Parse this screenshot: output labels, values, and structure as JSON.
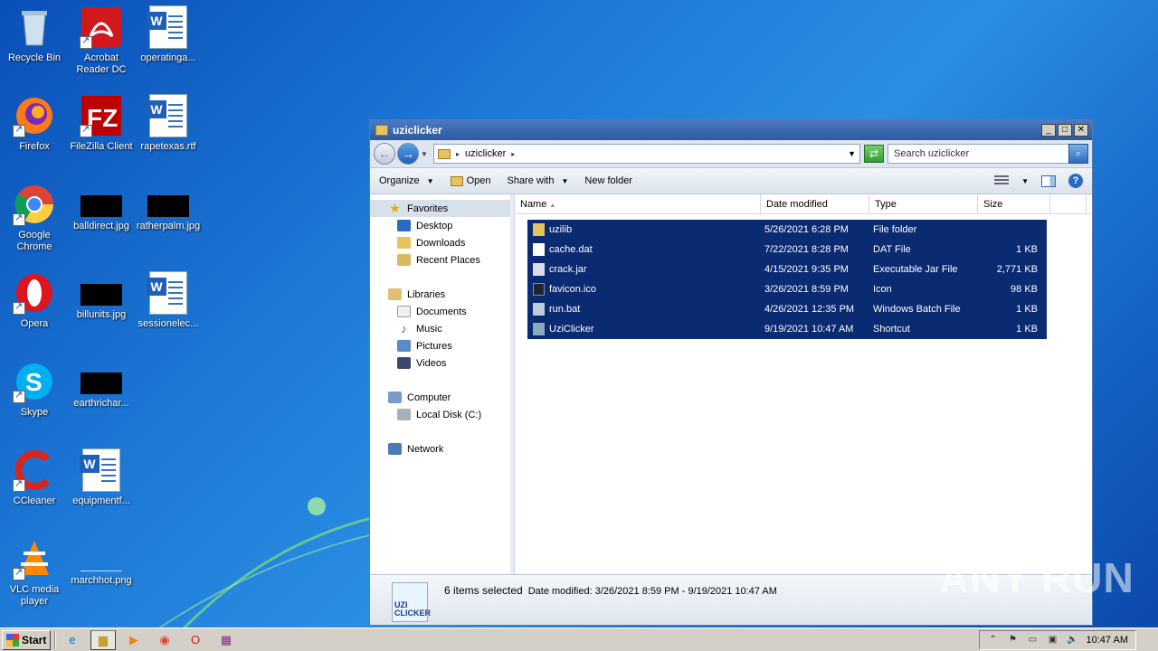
{
  "desktop": {
    "icons": [
      {
        "label": "Recycle Bin"
      },
      {
        "label": "Acrobat Reader DC"
      },
      {
        "label": "operatinga..."
      },
      {
        "label": "Firefox"
      },
      {
        "label": "FileZilla Client"
      },
      {
        "label": "rapetexas.rtf"
      },
      {
        "label": "Google Chrome"
      },
      {
        "label": "balldirect.jpg"
      },
      {
        "label": "ratherpalm.jpg"
      },
      {
        "label": "Opera"
      },
      {
        "label": "billunits.jpg"
      },
      {
        "label": "sessionelec..."
      },
      {
        "label": "Skype"
      },
      {
        "label": "earthrichar..."
      },
      {
        "label": "CCleaner"
      },
      {
        "label": "equipmentf..."
      },
      {
        "label": "VLC media player"
      },
      {
        "label": "marchhot.png"
      }
    ]
  },
  "window": {
    "title": "uziclicker",
    "address": "uziclicker",
    "search_placeholder": "Search uziclicker",
    "toolbar": {
      "organize": "Organize",
      "open": "Open",
      "share_with": "Share with",
      "new_folder": "New folder"
    },
    "nav": {
      "favorites": "Favorites",
      "desktop": "Desktop",
      "downloads": "Downloads",
      "recent_places": "Recent Places",
      "libraries": "Libraries",
      "documents": "Documents",
      "music": "Music",
      "pictures": "Pictures",
      "videos": "Videos",
      "computer": "Computer",
      "local_disk": "Local Disk (C:)",
      "network": "Network"
    },
    "columns": {
      "name": "Name",
      "date_modified": "Date modified",
      "type": "Type",
      "size": "Size"
    },
    "files": [
      {
        "name": "uzilib",
        "date": "5/26/2021 6:28 PM",
        "type": "File folder",
        "size": ""
      },
      {
        "name": "cache.dat",
        "date": "7/22/2021 8:28 PM",
        "type": "DAT File",
        "size": "1 KB"
      },
      {
        "name": "crack.jar",
        "date": "4/15/2021 9:35 PM",
        "type": "Executable Jar File",
        "size": "2,771 KB"
      },
      {
        "name": "favicon.ico",
        "date": "3/26/2021 8:59 PM",
        "type": "Icon",
        "size": "98 KB"
      },
      {
        "name": "run.bat",
        "date": "4/26/2021 12:35 PM",
        "type": "Windows Batch File",
        "size": "1 KB"
      },
      {
        "name": "UziClicker",
        "date": "9/19/2021 10:47 AM",
        "type": "Shortcut",
        "size": "1 KB"
      }
    ],
    "details": {
      "logo_text_1": "UZI",
      "logo_text_2": "CLICKER",
      "selected": "6 items selected",
      "date_label": "Date modified:",
      "date_range": "3/26/2021 8:59 PM - 9/19/2021 10:47 AM"
    }
  },
  "taskbar": {
    "start": "Start",
    "clock": "10:47 AM"
  },
  "watermark": "ANY RUN"
}
